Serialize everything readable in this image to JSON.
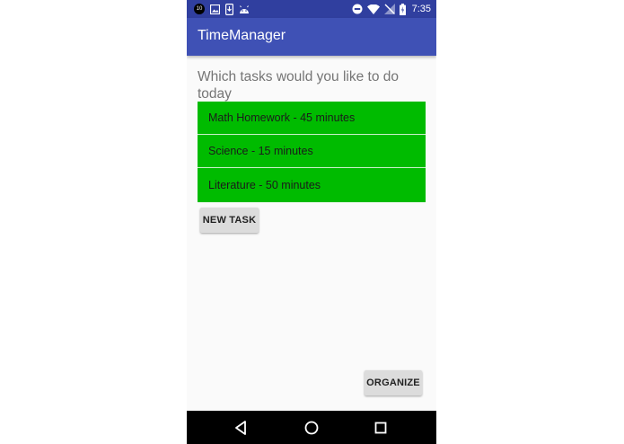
{
  "status_bar": {
    "notification_badge": "10",
    "time": "7:35",
    "left_icons": [
      "notification-badge-icon",
      "image-icon",
      "phone-download-icon",
      "android-icon"
    ],
    "right_icons": [
      "do-not-disturb-icon",
      "wifi-icon",
      "signal-off-icon",
      "battery-charging-icon"
    ]
  },
  "app_bar": {
    "title": "TimeManager"
  },
  "main": {
    "prompt": "Which tasks would you like to do today",
    "tasks": [
      {
        "label": "Math Homework - 45 minutes"
      },
      {
        "label": "Science - 15 minutes"
      },
      {
        "label": "Literature - 50 minutes"
      }
    ],
    "new_task_label": "NEW TASK",
    "organize_label": "ORGANIZE"
  },
  "nav_bar": {
    "buttons": [
      "back-icon",
      "home-icon",
      "recents-icon"
    ]
  },
  "colors": {
    "status_bar": "#303f9f",
    "app_bar": "#3f51b5",
    "task_background": "#00bb00",
    "button_background": "#dcdcdc",
    "screen_background": "#fafafa",
    "nav_bar": "#000000"
  }
}
